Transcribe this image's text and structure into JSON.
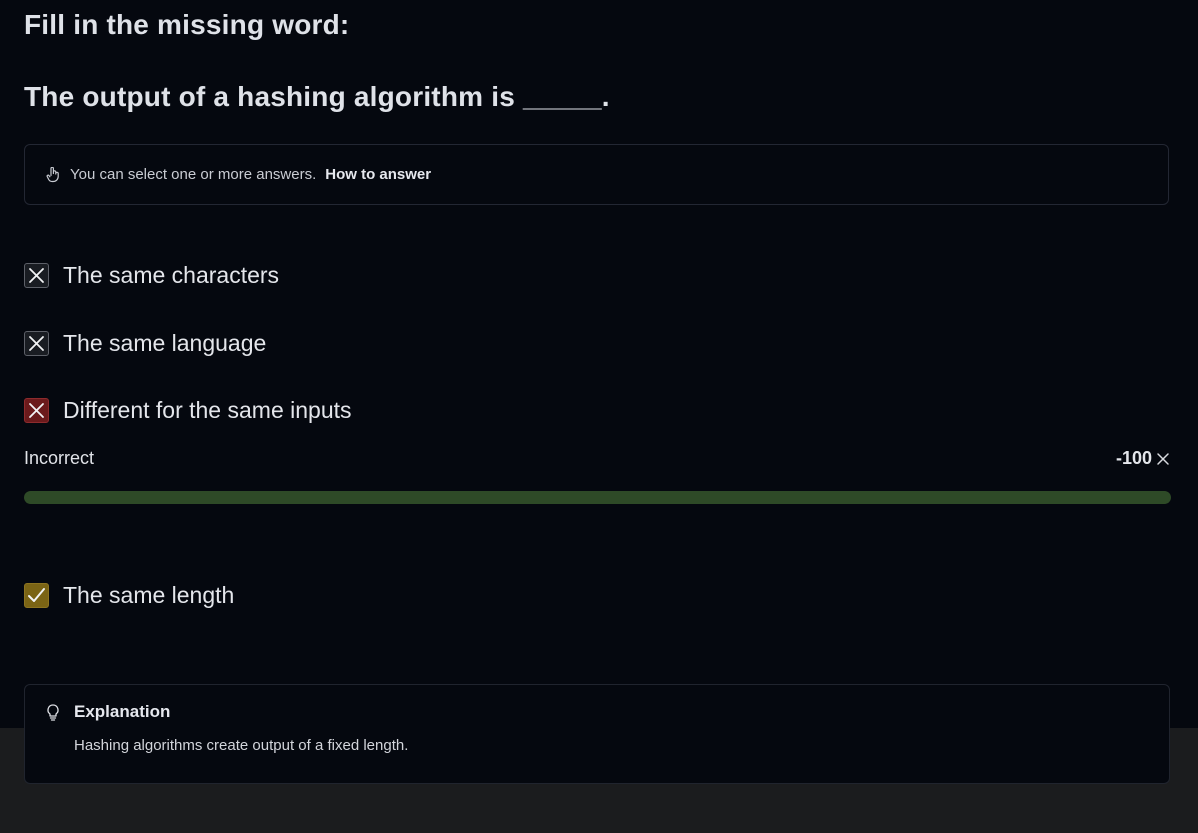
{
  "instruction": "Fill in the missing word:",
  "question": "The output of a hashing algorithm is _____.",
  "hint": {
    "icon": "pointing-hand-icon",
    "text": "You can select one or more answers.",
    "link": "How to answer"
  },
  "options": [
    {
      "label": "The same characters",
      "state": "incorrect-unselected"
    },
    {
      "label": "The same language",
      "state": "incorrect-unselected"
    },
    {
      "label": "Different for the same inputs",
      "state": "incorrect-selected"
    },
    {
      "label": "The same length",
      "state": "correct"
    }
  ],
  "result": {
    "label": "Incorrect",
    "score": "-100",
    "progress": 1.0
  },
  "explanation": {
    "icon": "lightbulb-icon",
    "title": "Explanation",
    "body": "Hashing algorithms create output of a fixed length."
  },
  "colors": {
    "background": "#05080f",
    "incorrect_selected": "#6b1a1c",
    "correct": "#7b6415",
    "progress_fill": "#2e4a27"
  }
}
